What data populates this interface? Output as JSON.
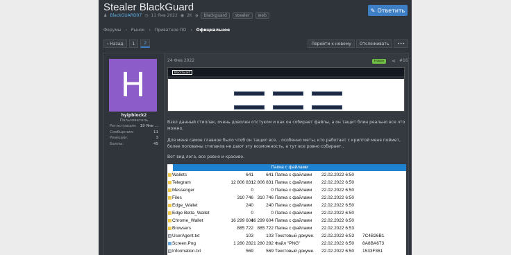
{
  "thread": {
    "title": "Stealer BlackGuard",
    "author": "BlackGUARD07",
    "date": "11 Янв 2022",
    "views": "2K",
    "tags": [
      "blackguard",
      "stealer",
      "web"
    ]
  },
  "reply_button": "Ответить",
  "breadcrumbs": [
    "Форумы",
    "Рынок",
    "Приватное ПО",
    "Официальное"
  ],
  "pager": {
    "back": "Назад",
    "pages": [
      "1",
      "2"
    ],
    "current": "2"
  },
  "tools": {
    "goto_new": "Перейти к новому",
    "watch": "Отслеживать",
    "more": "•••"
  },
  "user": {
    "avatar_letter": "H",
    "name": "hyipblock2",
    "role": "Пользователь",
    "stats": [
      {
        "label": "Регистрация:",
        "value": "19 Янв ..."
      },
      {
        "label": "Сообщения:",
        "value": "11"
      },
      {
        "label": "Реакции:",
        "value": "3"
      },
      {
        "label": "Баллы:",
        "value": "45"
      }
    ]
  },
  "post": {
    "date": "24 Фев 2022",
    "badge": "Новое",
    "number": "#16",
    "para1": "Взял данный стиллак, очень доволен отстуком и как он собирает файлы, а он тащит блин реально все что можно.",
    "para2": "Для меня самое главное было чтоб он тащил все... особенно меты, кто работает с криптой меня поймет, более половины стилаков не дают эту возможность, а тут все ровно собирает..",
    "para3": "Вот вид лога, все ровно и красиво."
  },
  "screenshot_logo": "BlackGuard",
  "explorer": {
    "header": "Папка с файлами",
    "rows": [
      {
        "name": "Wallets",
        "s1": "641",
        "s2": "641",
        "type": "Папка с файлами",
        "date": "22.02.2022 6:50",
        "hash": "",
        "kind": "folder"
      },
      {
        "name": "Telegram",
        "s1": "12 806 831",
        "s2": "12 806 831",
        "type": "Папка с файлами",
        "date": "22.02.2022 6:50",
        "hash": "",
        "kind": "folder"
      },
      {
        "name": "Messenger",
        "s1": "0",
        "s2": "0",
        "type": "Папка с файлами",
        "date": "22.02.2022 6:50",
        "hash": "",
        "kind": "folder"
      },
      {
        "name": "Files",
        "s1": "310 746",
        "s2": "310 746",
        "type": "Папка с файлами",
        "date": "22.02.2022 6:50",
        "hash": "",
        "kind": "folder"
      },
      {
        "name": "Edge_Wallet",
        "s1": "240",
        "s2": "240",
        "type": "Папка с файлами",
        "date": "22.02.2022 6:50",
        "hash": "",
        "kind": "folder"
      },
      {
        "name": "Edge Betta_Wallet",
        "s1": "0",
        "s2": "0",
        "type": "Папка с файлами",
        "date": "22.02.2022 6:50",
        "hash": "",
        "kind": "folder"
      },
      {
        "name": "Chrome_Wallet",
        "s1": "16 299 604",
        "s2": "16 299 604",
        "type": "Папка с файлами",
        "date": "22.02.2022 6:50",
        "hash": "",
        "kind": "folder"
      },
      {
        "name": "Browsers",
        "s1": "885 722",
        "s2": "885 722",
        "type": "Папка с файлами",
        "date": "22.02.2022 6:53",
        "hash": "",
        "kind": "folder"
      },
      {
        "name": "UserAgent.txt",
        "s1": "103",
        "s2": "103",
        "type": "Текстовый докуме...",
        "date": "22.02.2022 6:53",
        "hash": "7C4B26B1",
        "kind": "file"
      },
      {
        "name": "Screen.Png",
        "s1": "1 280 282",
        "s2": "1 280 282",
        "type": "Файл \"PNG\"",
        "date": "22.02.2022 6:50",
        "hash": "8A8BA673",
        "kind": "fileimg"
      },
      {
        "name": "Information.txt",
        "s1": "569",
        "s2": "569",
        "type": "Текстовый докуме...",
        "date": "22.02.2022 6:50",
        "hash": "1533F361",
        "kind": "file"
      }
    ]
  }
}
